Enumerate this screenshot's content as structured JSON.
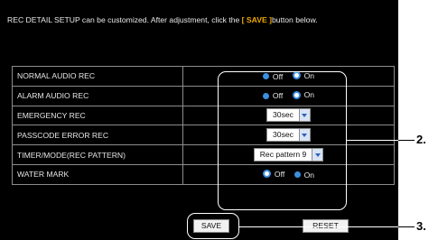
{
  "intro": {
    "text_before": "REC DETAIL SETUP can be customized. After adjustment, click the ",
    "save_word": "[ SAVE ]",
    "text_after": "button below."
  },
  "rows": {
    "normal_audio": {
      "label": "NORMAL AUDIO REC",
      "opt_off": "Off",
      "opt_on": "On",
      "selected": "On"
    },
    "alarm_audio": {
      "label": "ALARM AUDIO REC",
      "opt_off": "Off",
      "opt_on": "On",
      "selected": "On"
    },
    "emergency": {
      "label": "EMERGENCY REC",
      "value": "30sec"
    },
    "passcode": {
      "label": "PASSCODE ERROR REC",
      "value": "30sec"
    },
    "timer_mode": {
      "label": "TIMER/MODE(REC PATTERN)",
      "value": "Rec pattern 9"
    },
    "watermark": {
      "label": "WATER MARK",
      "opt_off": "Off",
      "opt_on": "On",
      "selected": "Off"
    }
  },
  "buttons": {
    "save": "SAVE",
    "reset": "RESET"
  },
  "callouts": {
    "two": "2.",
    "three": "3."
  },
  "colors": {
    "background": "#000000",
    "accent": "#f0a800",
    "radio": "#3b8fe0"
  }
}
